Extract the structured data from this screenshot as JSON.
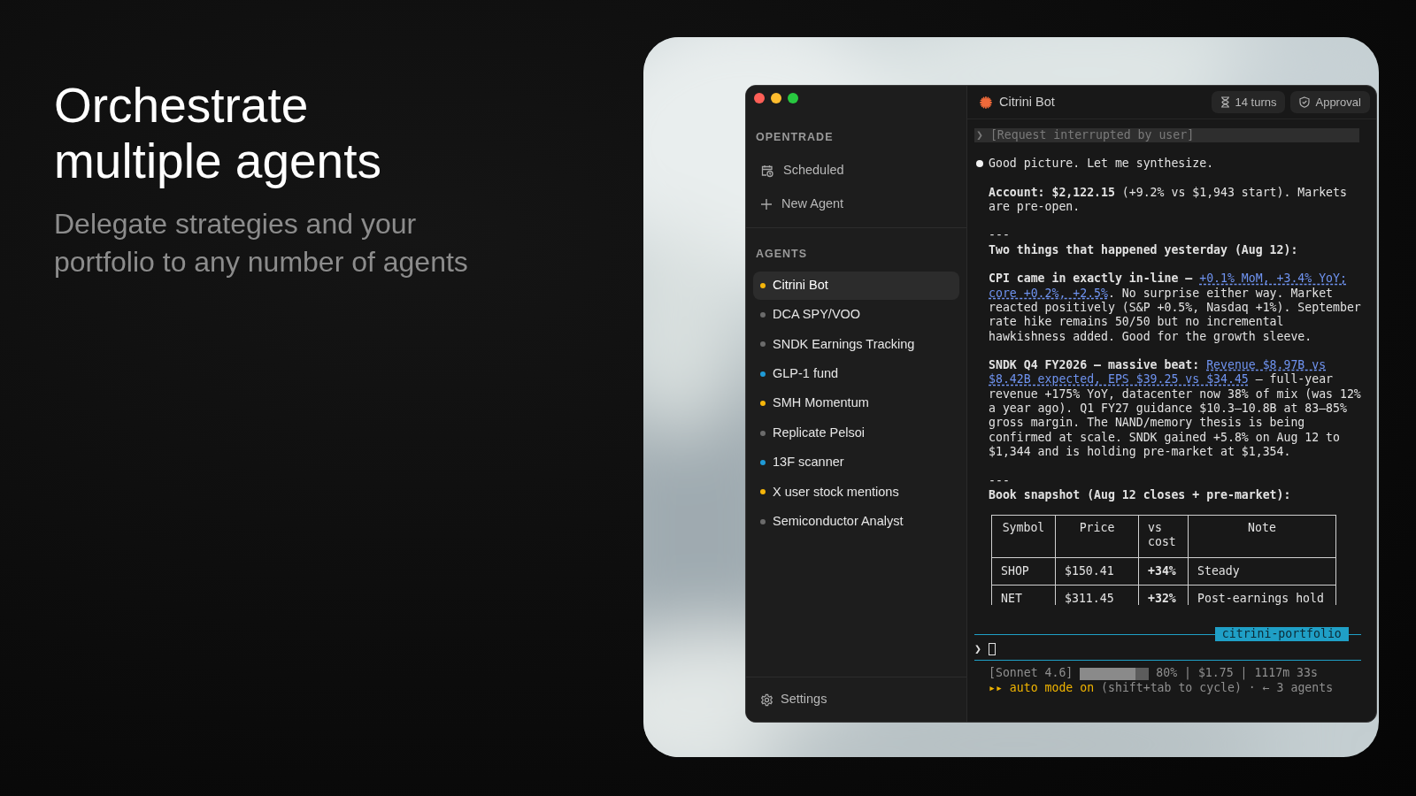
{
  "hero": {
    "title_lines": [
      "Orchestrate",
      "multiple agents"
    ],
    "subtitle_lines": [
      "Delegate strategies and your",
      "portfolio to any number of agents"
    ]
  },
  "sidebar": {
    "app_title": "OPENTRADE",
    "nav": [
      {
        "kind": "schedule",
        "label": "Scheduled"
      },
      {
        "kind": "new",
        "label": "New Agent"
      }
    ],
    "agents_title": "AGENTS",
    "agents": [
      {
        "name": "Citrini Bot",
        "color": "#f5b50a",
        "selected": true
      },
      {
        "name": "DCA SPY/VOO",
        "color": "#6b6b6b",
        "selected": false
      },
      {
        "name": "SNDK Earnings Tracking",
        "color": "#6b6b6b",
        "selected": false
      },
      {
        "name": "GLP-1 fund",
        "color": "#1f9ad6",
        "selected": false
      },
      {
        "name": "SMH Momentum",
        "color": "#f5b50a",
        "selected": false
      },
      {
        "name": "Replicate Pelsoi",
        "color": "#6b6b6b",
        "selected": false
      },
      {
        "name": "13F scanner",
        "color": "#1f9ad6",
        "selected": false
      },
      {
        "name": "X user stock mentions",
        "color": "#f5b50a",
        "selected": false
      },
      {
        "name": "Semiconductor Analyst",
        "color": "#6b6b6b",
        "selected": false
      }
    ],
    "settings": "Settings"
  },
  "header": {
    "title": "Citrini Bot",
    "chips": [
      {
        "kind": "turns",
        "label": "14 turns"
      },
      {
        "kind": "approval",
        "label": "Approval"
      }
    ]
  },
  "transcript": [
    {
      "kind": "interrupted",
      "text": "❯ [Request interrupted by user]"
    },
    {
      "kind": "bullet",
      "text": "Good picture. Let me synthesize."
    },
    {
      "kind": "paragraph",
      "lines": [
        [
          {
            "kind": "text",
            "text": "**Account: $2,122.15** (+9.2% vs $1,943 start). Markets"
          }
        ],
        [
          {
            "kind": "text",
            "text": "are pre-open."
          }
        ]
      ]
    },
    {
      "kind": "rule",
      "text": "---"
    },
    {
      "kind": "heading",
      "text": "Two things that happened yesterday (Aug 12):"
    },
    {
      "kind": "paragraph",
      "lines": [
        [
          {
            "kind": "text",
            "text": "**CPI came in exactly in-line —** "
          },
          {
            "kind": "link",
            "text": "+0.1% MoM, +3.4% YoY;"
          }
        ],
        [
          {
            "kind": "link",
            "text": "core +0.2%, +2.5%"
          },
          {
            "kind": "text",
            "text": ". No surprise either way. Market"
          }
        ],
        [
          {
            "kind": "text",
            "text": "reacted positively (S&P +0.5%, Nasdaq +1%). September"
          }
        ],
        [
          {
            "kind": "text",
            "text": "rate hike remains 50/50 but no incremental"
          }
        ],
        [
          {
            "kind": "text",
            "text": "hawkishness added. Good for the growth sleeve."
          }
        ]
      ]
    },
    {
      "kind": "paragraph",
      "lines": [
        [
          {
            "kind": "text",
            "text": "**SNDK Q4 FY2026 — massive beat:** "
          },
          {
            "kind": "link",
            "text": "Revenue $8.97B vs"
          }
        ],
        [
          {
            "kind": "link",
            "text": "$8.42B expected, EPS $39.25 vs $34.45"
          },
          {
            "kind": "text",
            "text": " — full-year"
          }
        ],
        [
          {
            "kind": "text",
            "text": "revenue +175% YoY, datacenter now 38% of mix (was 12%"
          }
        ],
        [
          {
            "kind": "text",
            "text": "a year ago). Q1 FY27 guidance $10.3–10.8B at 83–85%"
          }
        ],
        [
          {
            "kind": "text",
            "text": "gross margin. The NAND/memory thesis is being"
          }
        ],
        [
          {
            "kind": "text",
            "text": "confirmed at scale. SNDK gained +5.8% on Aug 12 to"
          }
        ],
        [
          {
            "kind": "text",
            "text": "$1,344 and is holding pre-market at $1,354."
          }
        ]
      ]
    },
    {
      "kind": "rule",
      "text": "---"
    },
    {
      "kind": "heading",
      "text": "Book snapshot (Aug 12 closes + pre-market):"
    },
    {
      "kind": "table",
      "columns": [
        "Symbol",
        "Price",
        "vs cost",
        "Note"
      ],
      "rows": [
        [
          "SHOP",
          "$150.41",
          "+34%",
          "Steady"
        ],
        [
          "NET",
          "$311.45",
          "+32%",
          "Post-earnings hold"
        ]
      ]
    }
  ],
  "input": {
    "tag": "citrini-portfolio",
    "prompt": "❯"
  },
  "status": {
    "model": "[Sonnet 4.6]",
    "context": {
      "level": 0.8
    },
    "reading": "80% | $1.75 | 1117m 33s",
    "mode": "▸▸ auto mode on",
    "hint": "(shift+tab to cycle) · ← 3 agents"
  }
}
